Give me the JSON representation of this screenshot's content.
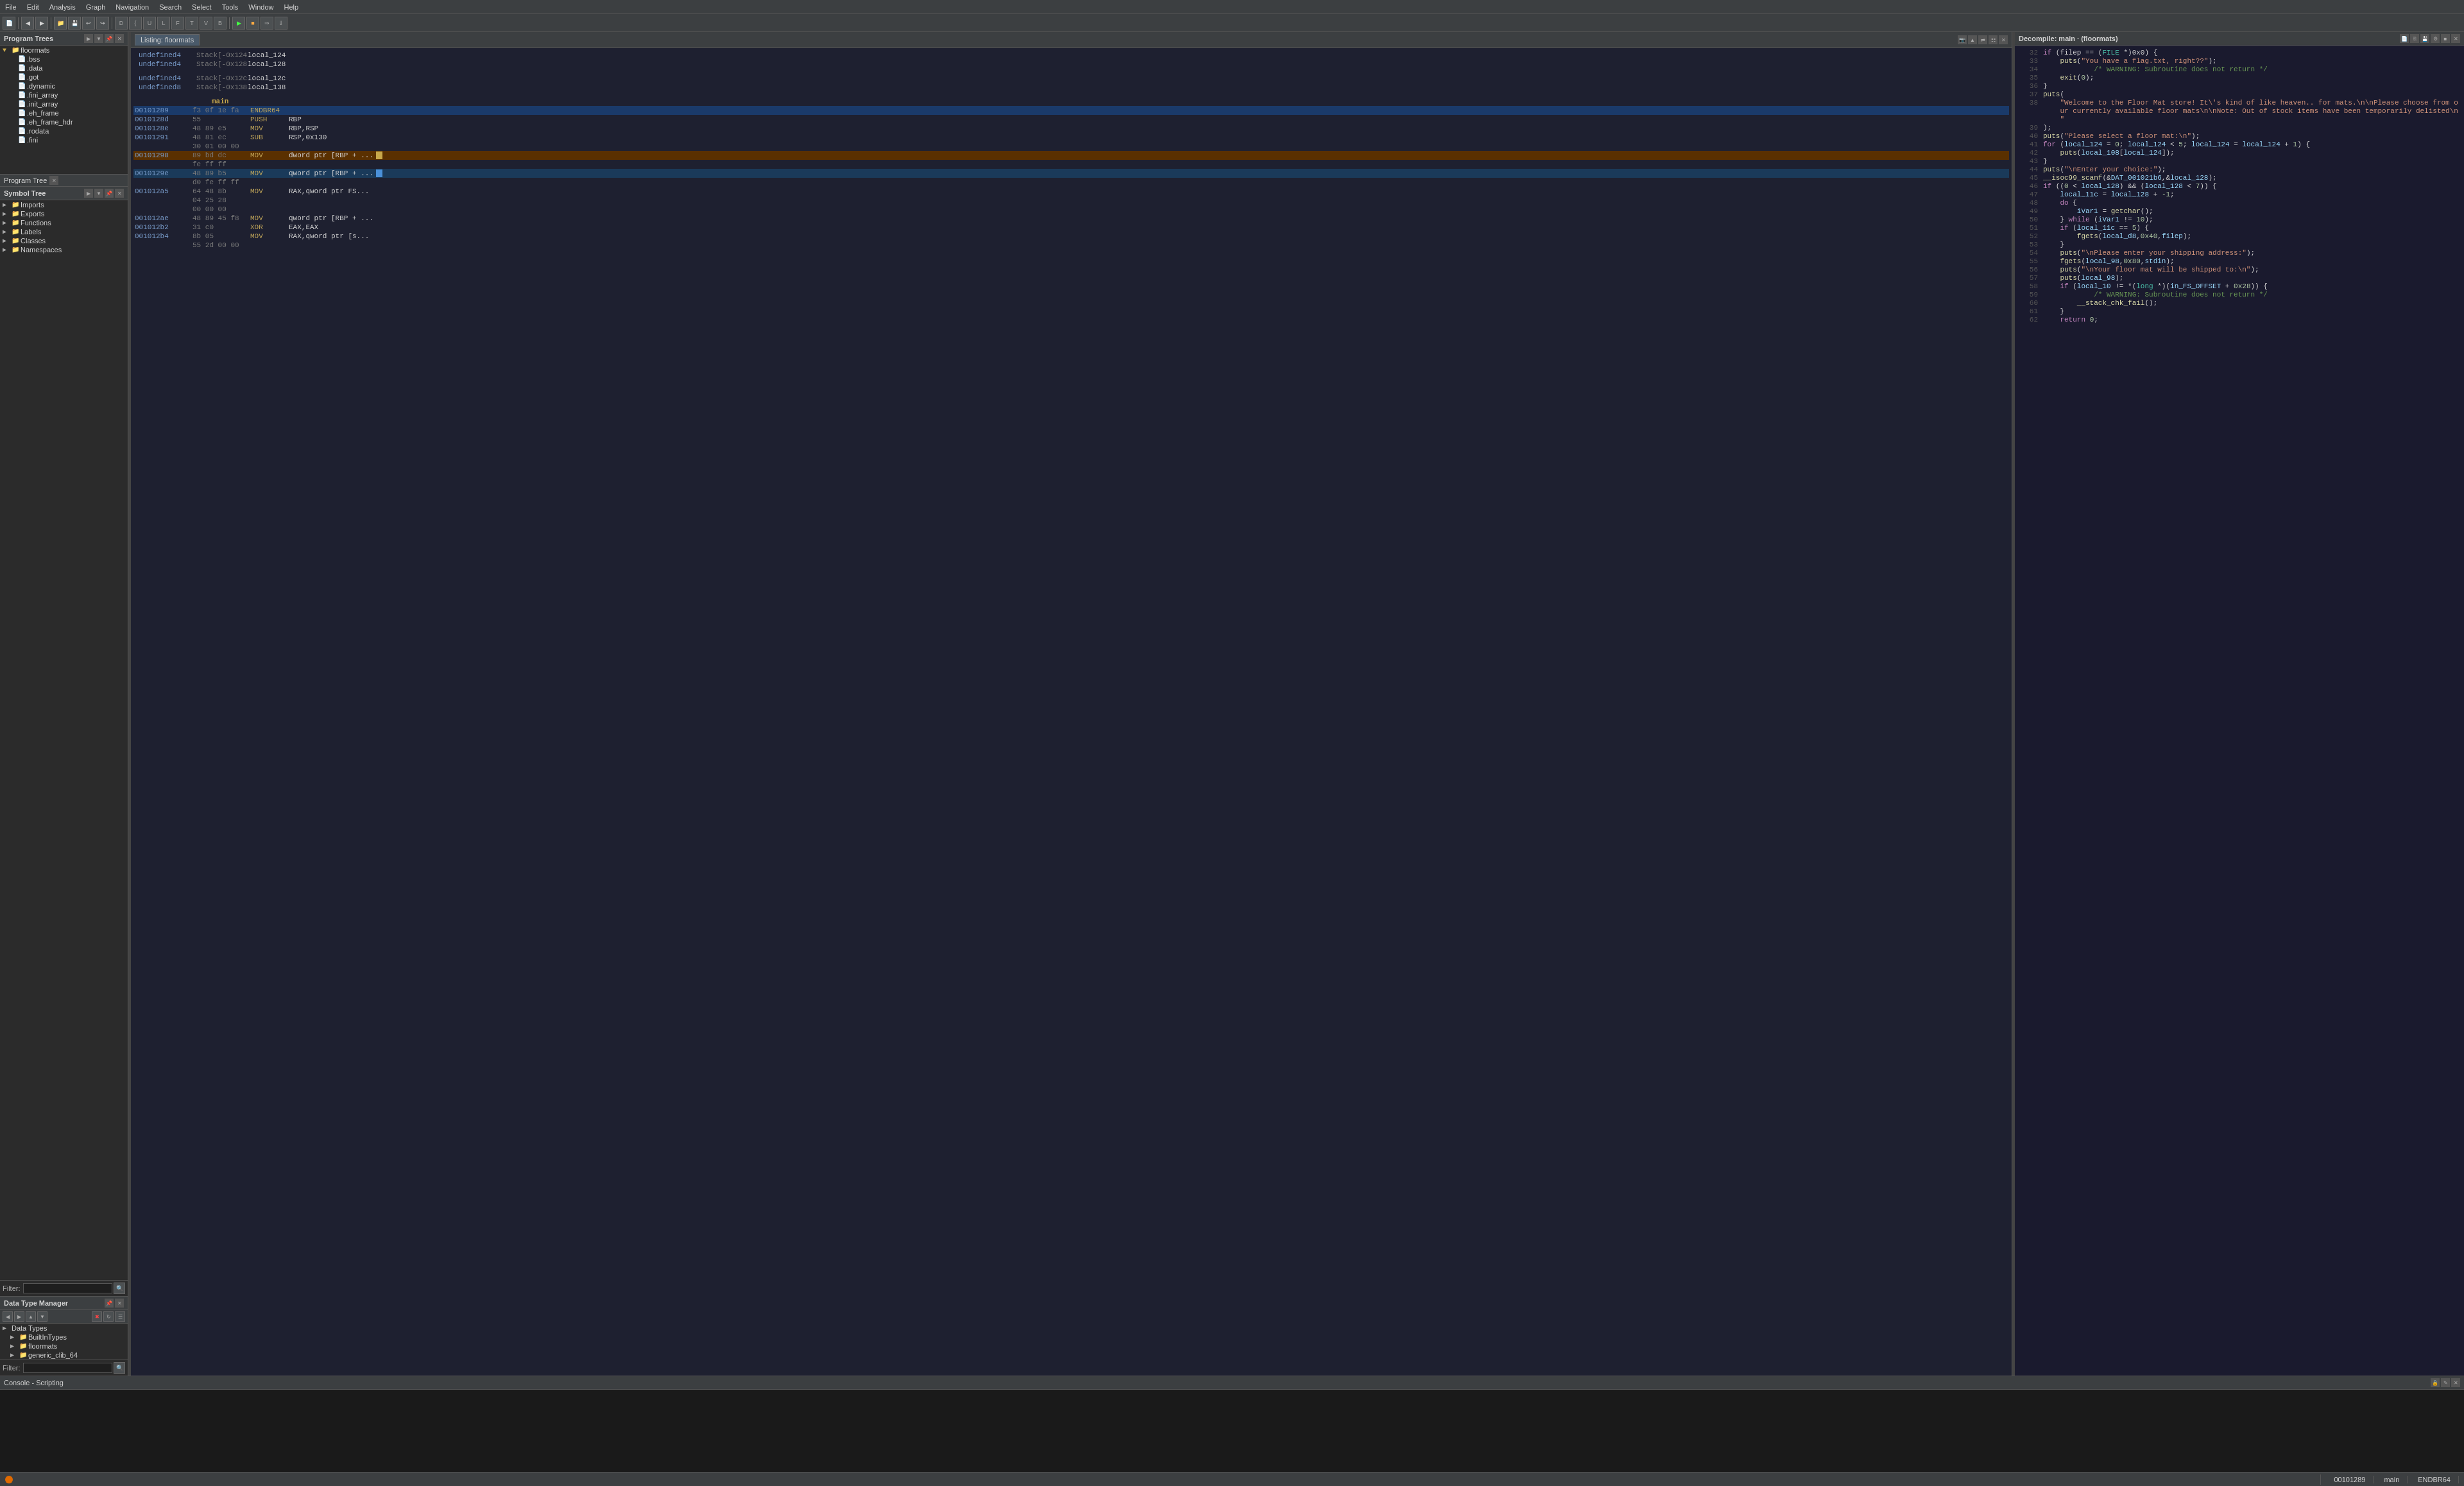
{
  "menubar": {
    "items": [
      "File",
      "Edit",
      "Analysis",
      "Graph",
      "Navigation",
      "Search",
      "Select",
      "Tools",
      "Window",
      "Help"
    ]
  },
  "program_trees": {
    "title": "Program Trees",
    "file": "floormats",
    "nodes": [
      {
        "label": ".bss",
        "indent": 2,
        "type": "file"
      },
      {
        "label": ".data",
        "indent": 2,
        "type": "file"
      },
      {
        "label": ".got",
        "indent": 2,
        "type": "file"
      },
      {
        "label": ".dynamic",
        "indent": 2,
        "type": "file"
      },
      {
        "label": ".fini_array",
        "indent": 2,
        "type": "file"
      },
      {
        "label": ".init_array",
        "indent": 2,
        "type": "file"
      },
      {
        "label": ".eh_frame",
        "indent": 2,
        "type": "file"
      },
      {
        "label": ".eh_frame_hdr",
        "indent": 2,
        "type": "file"
      },
      {
        "label": ".rodata",
        "indent": 2,
        "type": "file"
      },
      {
        "label": ".fini",
        "indent": 2,
        "type": "file"
      }
    ]
  },
  "symbol_tree": {
    "title": "Symbol Tree",
    "nodes": [
      {
        "label": "Imports",
        "indent": 0,
        "type": "folder"
      },
      {
        "label": "Exports",
        "indent": 0,
        "type": "folder"
      },
      {
        "label": "Functions",
        "indent": 0,
        "type": "folder"
      },
      {
        "label": "Labels",
        "indent": 0,
        "type": "folder"
      },
      {
        "label": "Classes",
        "indent": 0,
        "type": "folder"
      },
      {
        "label": "Namespaces",
        "indent": 0,
        "type": "folder"
      }
    ],
    "filter_placeholder": "Filter:"
  },
  "data_type_manager": {
    "title": "Data Type Manager",
    "nodes": [
      {
        "label": "Data Types",
        "indent": 0,
        "type": "folder"
      },
      {
        "label": "BuiltInTypes",
        "indent": 1,
        "type": "folder",
        "color": "blue"
      },
      {
        "label": "floormats",
        "indent": 1,
        "type": "folder",
        "color": "orange"
      },
      {
        "label": "generic_clib_64",
        "indent": 1,
        "type": "folder",
        "color": "orange"
      }
    ],
    "filter_placeholder": "Filter:"
  },
  "listing": {
    "title": "Listing: floormats",
    "stack_vars": [
      {
        "type": "undefined4",
        "name": "Stack[-0x124... local_124"
      },
      {
        "type": "undefined4",
        "name": "Stack[-0x128... local_128"
      },
      {
        "type": "undefined4",
        "name": "Stack[-0x12c... local_12c"
      },
      {
        "type": "undefined8",
        "name": "Stack[-0x138... local_138"
      }
    ],
    "main_label": "main",
    "instructions": [
      {
        "addr": "00101289",
        "bytes": "f3 0f 1e fa",
        "mnem": "ENDBR64",
        "ops": "",
        "selected": true
      },
      {
        "addr": "0010128d",
        "bytes": "55",
        "mnem": "PUSH",
        "ops": "RBP"
      },
      {
        "addr": "0010128e",
        "bytes": "48 89 e5",
        "mnem": "MOV",
        "ops": "RBP,RSP"
      },
      {
        "addr": "00101291",
        "bytes": "48 81 ec",
        "mnem": "SUB",
        "ops": "RSP,0x130"
      },
      {
        "addr": "",
        "bytes": "30 01 00 00",
        "mnem": "",
        "ops": ""
      },
      {
        "addr": "00101298",
        "bytes": "89 bd dc",
        "mnem": "MOV",
        "ops": "dword ptr [RBP + ...",
        "highlight": "orange"
      },
      {
        "addr": "",
        "bytes": "fe ff ff",
        "mnem": "",
        "ops": ""
      },
      {
        "addr": "0010129e",
        "bytes": "48 89 b5",
        "mnem": "MOV",
        "ops": "qword ptr [RBP + ...",
        "highlight": "blue"
      },
      {
        "addr": "",
        "bytes": "d0 fe ff ff",
        "mnem": "",
        "ops": ""
      },
      {
        "addr": "001012a5",
        "bytes": "64 48 8b",
        "mnem": "MOV",
        "ops": "RAX,qword ptr FS..."
      },
      {
        "addr": "",
        "bytes": "04 25 28",
        "mnem": "",
        "ops": ""
      },
      {
        "addr": "",
        "bytes": "00 00 00",
        "mnem": "",
        "ops": ""
      },
      {
        "addr": "001012ae",
        "bytes": "48 89 45 f8",
        "mnem": "MOV",
        "ops": "qword ptr [RBP + ..."
      },
      {
        "addr": "001012b2",
        "bytes": "31 c0",
        "mnem": "XOR",
        "ops": "EAX,EAX"
      },
      {
        "addr": "001012b4",
        "bytes": "8b 05",
        "mnem": "MOV",
        "ops": "RAX,qword ptr [s..."
      },
      {
        "addr": "",
        "bytes": "55 2d 00 00",
        "mnem": "",
        "ops": ""
      }
    ]
  },
  "decompiler": {
    "title": "Decompile: main · (floormats)",
    "lines": [
      {
        "num": "32",
        "text": "if (filep == (FILE *)0x0) {"
      },
      {
        "num": "33",
        "text": "    puts(\"You have a flag.txt, right??\");"
      },
      {
        "num": "34",
        "text": "            /* WARNING: Subroutine does not return */"
      },
      {
        "num": "35",
        "text": "    exit(0);"
      },
      {
        "num": "36",
        "text": "}"
      },
      {
        "num": "37",
        "text": "puts("
      },
      {
        "num": "38",
        "text": "    \"Welcome to the Floor Mat store! It\\'s kind of like heaven.. for mats.\\n\\nPlease choose from o"
      },
      {
        "num": "",
        "text": "    ur currently available floor mats\\n\\nNote: Out of stock items have been temporarily delisted\\n"
      },
      {
        "num": "",
        "text": "    \""
      },
      {
        "num": "39",
        "text": ");"
      },
      {
        "num": "40",
        "text": "puts(\"Please select a floor mat:\\n\");"
      },
      {
        "num": "41",
        "text": "for (local_124 = 0; local_124 < 5; local_124 = local_124 + 1) {"
      },
      {
        "num": "42",
        "text": "    puts(local_108[local_124]);"
      },
      {
        "num": "43",
        "text": "}"
      },
      {
        "num": "44",
        "text": "puts(\"\\nEnter your choice:\");"
      },
      {
        "num": "45",
        "text": "__isoc99_scanf(&DAT_001021b6,&local_128);"
      },
      {
        "num": "46",
        "text": "if ((0 < local_128) && (local_128 < 7)) {"
      },
      {
        "num": "47",
        "text": "    local_11c = local_128 + -1;"
      },
      {
        "num": "48",
        "text": "    do {"
      },
      {
        "num": "49",
        "text": "        iVar1 = getchar();"
      },
      {
        "num": "50",
        "text": "    } while (iVar1 != 10);"
      },
      {
        "num": "51",
        "text": "    if (local_11c == 5) {"
      },
      {
        "num": "52",
        "text": "        fgets(local_d8,0x40,filep);"
      },
      {
        "num": "53",
        "text": "    }"
      },
      {
        "num": "54",
        "text": "    puts(\"\\nPlease enter your shipping address:\");"
      },
      {
        "num": "55",
        "text": "    fgets(local_98,0x80,stdin);"
      },
      {
        "num": "56",
        "text": "    puts(\"\\nYour floor mat will be shipped to:\\n\");"
      },
      {
        "num": "57",
        "text": "    puts(local_98);"
      },
      {
        "num": "58",
        "text": "    if (local_10 != *(long *)(in_FS_OFFSET + 0x28)) {"
      },
      {
        "num": "59",
        "text": "            /* WARNING: Subroutine does not return */"
      },
      {
        "num": "60",
        "text": "        __stack_chk_fail();"
      },
      {
        "num": "61",
        "text": "    }"
      },
      {
        "num": "62",
        "text": "    return 0;"
      }
    ]
  },
  "console": {
    "title": "Console - Scripting"
  },
  "status_bar": {
    "address": "00101289",
    "function": "main",
    "instruction": "ENDBR64"
  }
}
